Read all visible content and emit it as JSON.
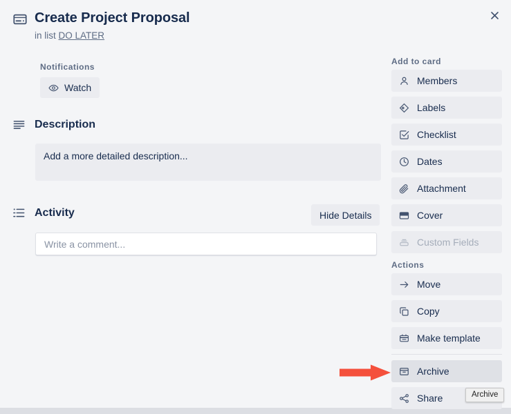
{
  "window": {
    "close_icon": "close-icon"
  },
  "card": {
    "icon": "card-icon",
    "title": "Create Project Proposal",
    "in_list_prefix": "in list",
    "list_name": "DO LATER"
  },
  "notifications": {
    "label": "Notifications",
    "watch_label": "Watch",
    "watch_icon": "eye-icon"
  },
  "description": {
    "icon": "description-lines-icon",
    "heading": "Description",
    "placeholder": "Add a more detailed description..."
  },
  "activity": {
    "icon": "activity-list-icon",
    "heading": "Activity",
    "hide_details_label": "Hide Details",
    "comment_placeholder": "Write a comment..."
  },
  "sidebar": {
    "add_to_card_label": "Add to card",
    "add_to_card_items": [
      {
        "label": "Members",
        "icon": "person-icon",
        "disabled": false
      },
      {
        "label": "Labels",
        "icon": "tag-icon",
        "disabled": false
      },
      {
        "label": "Checklist",
        "icon": "checkbox-icon",
        "disabled": false
      },
      {
        "label": "Dates",
        "icon": "clock-icon",
        "disabled": false
      },
      {
        "label": "Attachment",
        "icon": "paperclip-icon",
        "disabled": false
      },
      {
        "label": "Cover",
        "icon": "cover-icon",
        "disabled": false
      },
      {
        "label": "Custom Fields",
        "icon": "layers-icon",
        "disabled": true
      }
    ],
    "actions_label": "Actions",
    "actions_items": [
      {
        "label": "Move",
        "icon": "arrow-right-icon",
        "highlighted": false
      },
      {
        "label": "Copy",
        "icon": "copy-icon",
        "highlighted": false
      },
      {
        "label": "Make template",
        "icon": "template-icon",
        "highlighted": false
      },
      {
        "label": "Archive",
        "icon": "archive-icon",
        "highlighted": true
      },
      {
        "label": "Share",
        "icon": "share-icon",
        "highlighted": false
      }
    ]
  },
  "annotation": {
    "arrow_color": "#f4503c",
    "arrow_target": "Archive"
  },
  "tooltip": {
    "text": "Archive"
  },
  "colors": {
    "modal_background": "#f4f5f7",
    "button_background": "#ebecf0",
    "button_highlight": "#dfe1e6",
    "text_primary": "#172b4d",
    "text_subtle": "#5e6c84",
    "text_disabled": "#a5adba",
    "page_behind": "#dcdee3"
  }
}
